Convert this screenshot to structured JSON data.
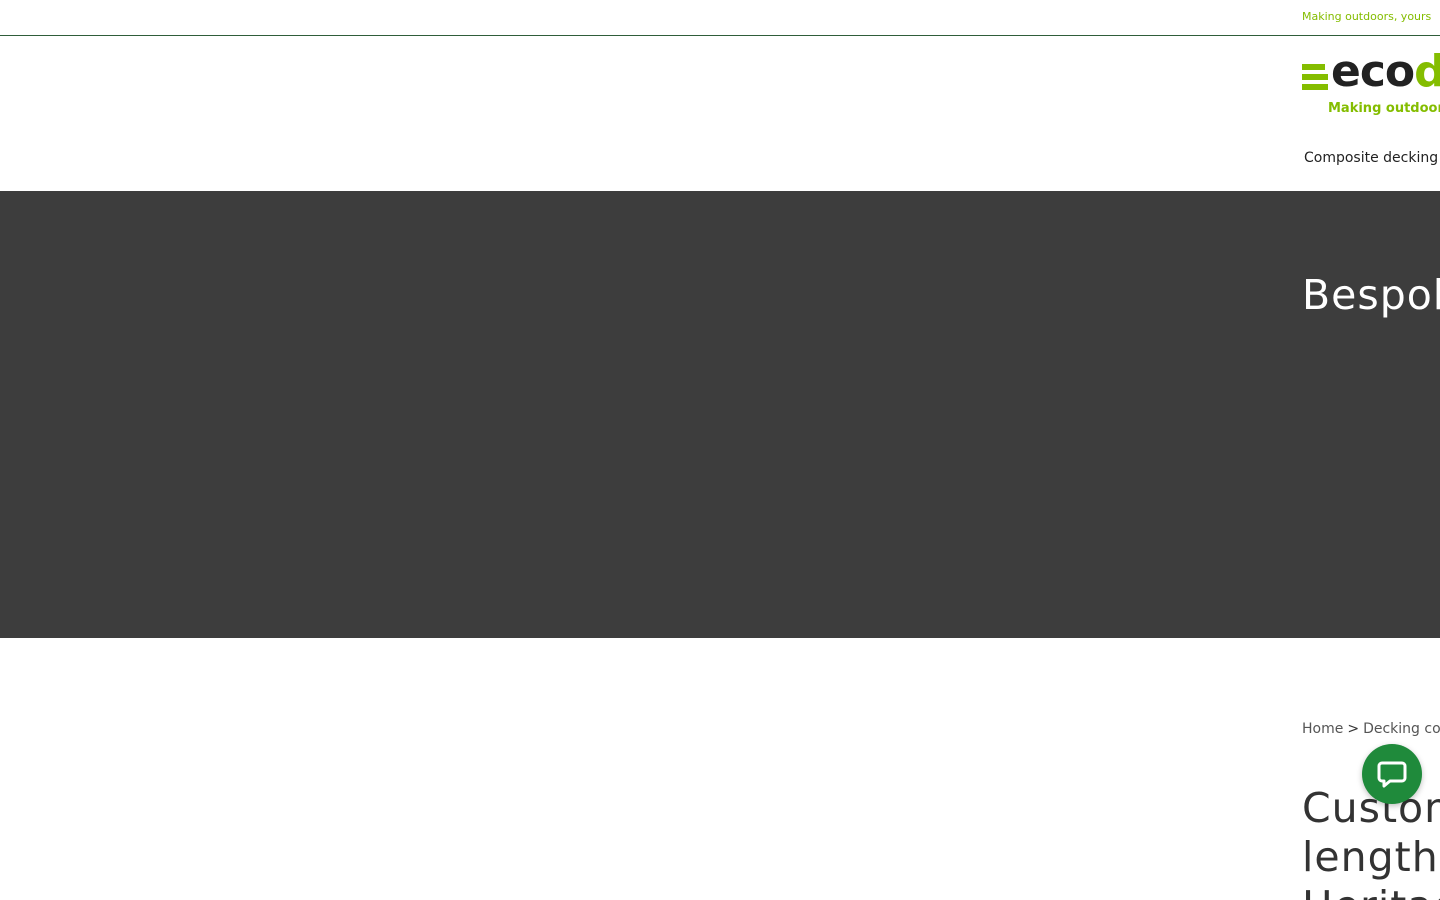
{
  "topbar": {
    "tagline": "Making outdoors, yours"
  },
  "logo": {
    "word_dark": "eco",
    "word_green": "d",
    "tagline": "Making outdoors, y"
  },
  "nav": {
    "items": [
      {
        "label": "Composite decking",
        "icon": "chevron-down-icon"
      }
    ]
  },
  "hero": {
    "title": "Bespok"
  },
  "breadcrumb": {
    "home": "Home",
    "separator": ">",
    "current": "Decking colle"
  },
  "product": {
    "title_lines": [
      "Custom",
      "length",
      "Heritag"
    ]
  },
  "chat": {
    "icon": "chat-bubble-icon"
  },
  "colors": {
    "brand_green": "#84bd00",
    "hero_bg": "#3d3d3d",
    "chat_green": "#1f8a3b"
  }
}
